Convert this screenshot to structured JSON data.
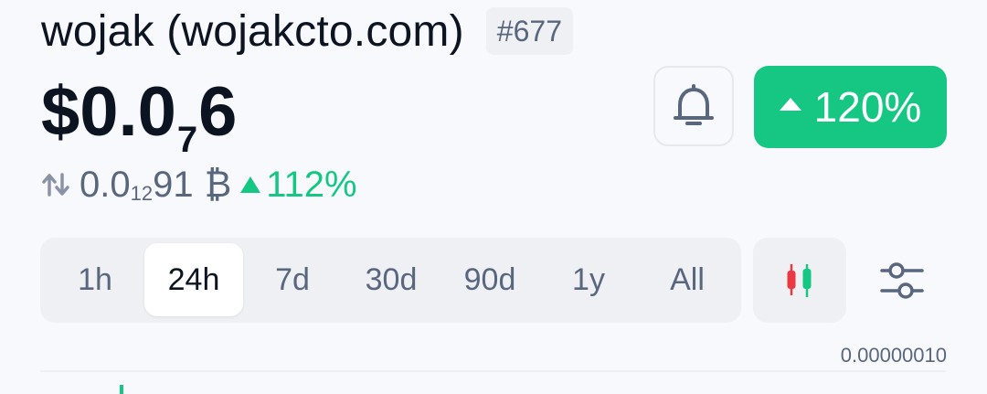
{
  "coin": {
    "name": "wojak (wojakcto.com)",
    "rank": "#677"
  },
  "price": {
    "prefix": "$0.0",
    "zeros": "7",
    "digits": "6"
  },
  "btc_price": {
    "prefix": "0.0",
    "zeros": "12",
    "digits": "91",
    "symbol": "₿",
    "change": "112%"
  },
  "change_button": {
    "label": "120%"
  },
  "time_ranges": [
    "1h",
    "24h",
    "7d",
    "30d",
    "90d",
    "1y",
    "All"
  ],
  "selected_range": "24h",
  "chart": {
    "axis_value": "0.00000010"
  },
  "colors": {
    "up_green": "#16c784",
    "down_red": "#ea3943",
    "text_primary": "#0d1421",
    "text_secondary": "#58667e"
  },
  "icons": {
    "bell": "bell-icon",
    "swap": "swap-arrows-icon",
    "candle": "candlestick-chart-icon",
    "settings": "sliders-icon"
  }
}
